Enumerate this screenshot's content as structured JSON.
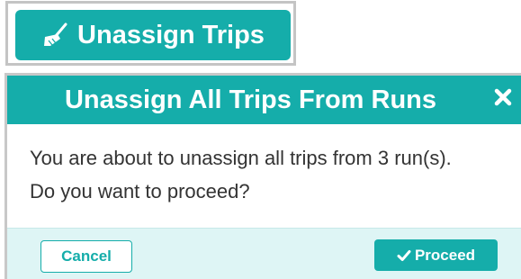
{
  "colors": {
    "accent": "#15adaa",
    "footer_bg": "#def5f5",
    "text": "#333333"
  },
  "toolbar": {
    "unassign_label": "Unassign Trips",
    "unassign_icon": "broom-icon"
  },
  "modal": {
    "title": "Unassign All Trips From Runs",
    "close_icon": "close-icon",
    "message": "You are about to unassign all trips from 3 run(s). Do you want to proceed?",
    "cancel_label": "Cancel",
    "proceed_label": "Proceed",
    "proceed_icon": "check-icon"
  }
}
